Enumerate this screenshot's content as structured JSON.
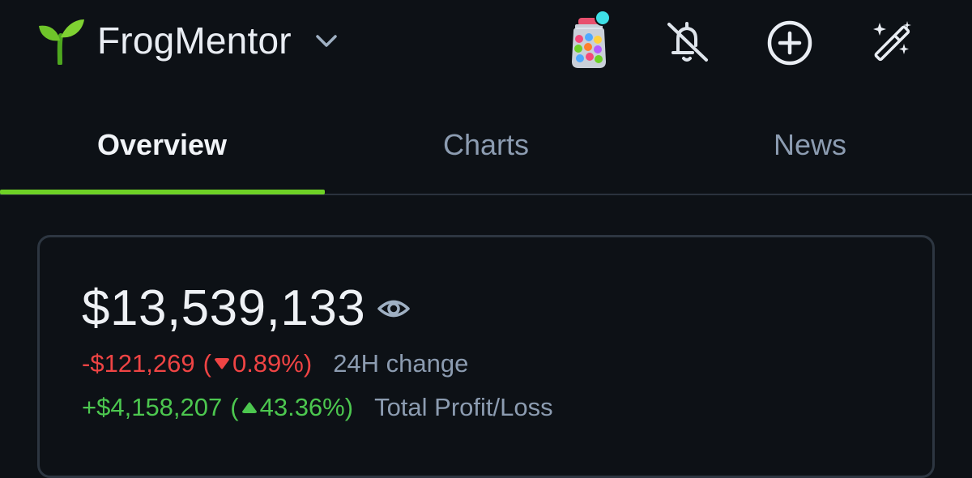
{
  "header": {
    "app_name": "FrogMentor",
    "icons": {
      "logo": "sprout-icon",
      "dropdown": "chevron-down-icon",
      "jar": "candy-jar-icon",
      "notifications": "bell-off-icon",
      "add": "plus-circle-icon",
      "magic": "magic-wand-icon"
    }
  },
  "tabs": [
    {
      "label": "Overview",
      "active": true
    },
    {
      "label": "Charts",
      "active": false
    },
    {
      "label": "News",
      "active": false
    }
  ],
  "portfolio": {
    "total_value": "$13,539,133",
    "change_24h": {
      "amount": "-$121,269",
      "open": "(",
      "percent": "0.89%)",
      "label": "24H change"
    },
    "total_pl": {
      "amount": "+$4,158,207",
      "open": "(",
      "percent": "43.36%)",
      "label": "Total Profit/Loss"
    }
  },
  "colors": {
    "background": "#0d1116",
    "accent": "#6ed126",
    "negative": "#ef4444",
    "positive": "#4cc74f",
    "muted": "#8c9cb1"
  }
}
